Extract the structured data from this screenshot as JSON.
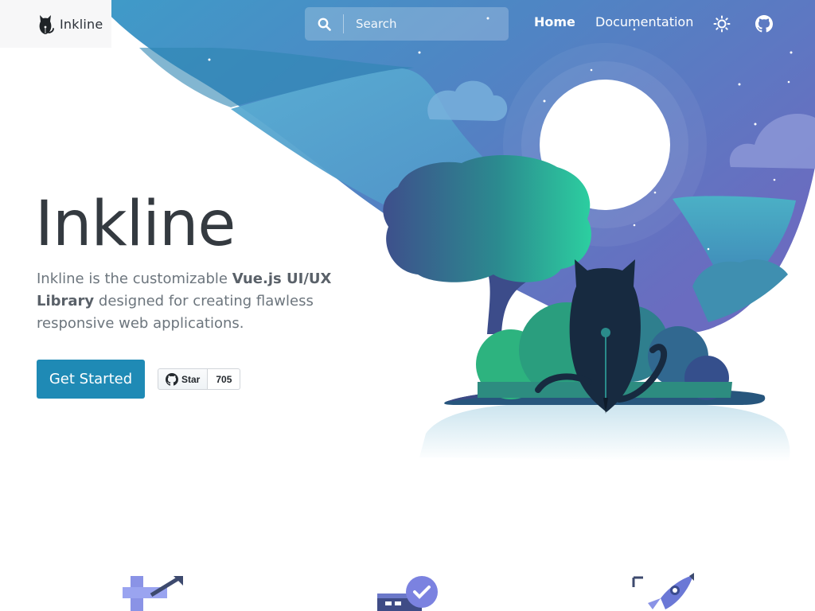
{
  "brand": {
    "name": "Inkline"
  },
  "search": {
    "placeholder": "Search"
  },
  "nav": {
    "home": "Home",
    "documentation": "Documentation"
  },
  "icons": {
    "logo": "cat-logo-icon",
    "search": "search-icon",
    "theme": "sun-icon",
    "github": "github-icon"
  },
  "hero": {
    "title": "Inkline",
    "desc_pre": "Inkline is the customizable ",
    "desc_bold": "Vue.js UI/UX Library",
    "desc_post": " designed for creating flawless responsive web applications.",
    "cta": "Get Started"
  },
  "github_star": {
    "label": "Star",
    "count": "705"
  },
  "features": [
    "crop-tool-icon",
    "browser-check-icon",
    "rocket-icon"
  ],
  "colors": {
    "primary": "#1f8ab5",
    "text": "#343a40",
    "muted": "#6c757d",
    "sky_top": "#4a9cc8",
    "sky_bottom": "#6a6fc0"
  }
}
